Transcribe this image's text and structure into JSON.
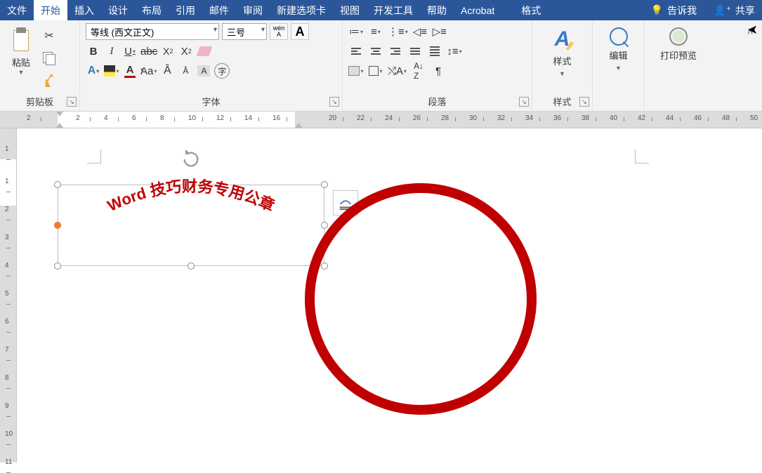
{
  "menu": {
    "file": "文件",
    "home": "开始",
    "insert": "插入",
    "design": "设计",
    "layout": "布局",
    "references": "引用",
    "mailings": "邮件",
    "review": "审阅",
    "newtab": "新建选项卡",
    "view": "视图",
    "dev": "开发工具",
    "help": "帮助",
    "acrobat": "Acrobat",
    "format": "格式",
    "tell": "告诉我",
    "share": "共享"
  },
  "ribbon": {
    "clipboard": {
      "label": "剪贴板",
      "paste": "粘贴"
    },
    "font": {
      "label": "字体",
      "name": "等线 (西文正文)",
      "size": "三号",
      "wen": "wén",
      "aa": "Aa",
      "zi": "字"
    },
    "paragraph": {
      "label": "段落"
    },
    "styles": {
      "label": "样式",
      "btn": "样式"
    },
    "edit": {
      "btn": "编辑"
    },
    "preview": {
      "btn": "打印预览"
    }
  },
  "ruler_h": [
    "2",
    "2",
    "4",
    "6",
    "8",
    "10",
    "12",
    "14",
    "16",
    "20",
    "22",
    "24",
    "26",
    "28",
    "30",
    "32",
    "34",
    "36",
    "38",
    "40",
    "42",
    "44",
    "46",
    "48",
    "50"
  ],
  "ruler_v": [
    "1",
    "1",
    "2",
    "3",
    "4",
    "5",
    "6",
    "7",
    "8",
    "9",
    "10",
    "11"
  ],
  "doc": {
    "arc_text": "Word 技巧财务专用公章"
  }
}
